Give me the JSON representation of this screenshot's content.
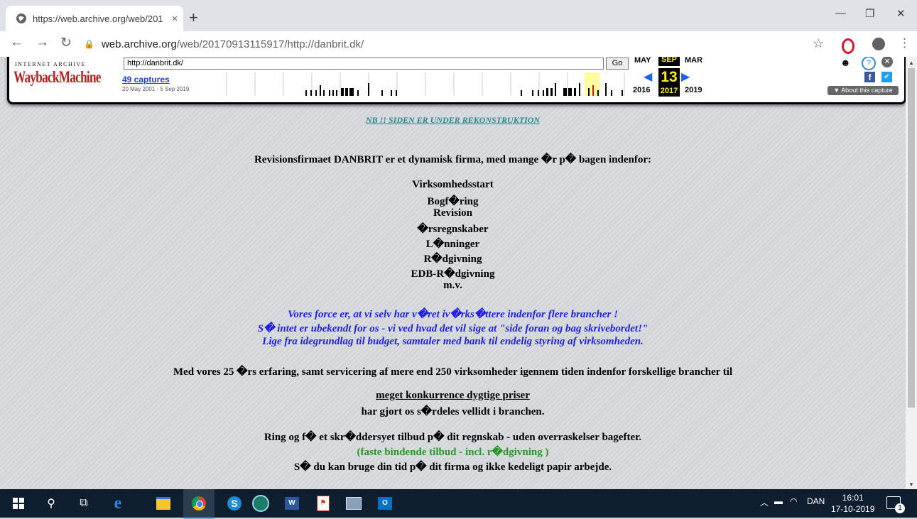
{
  "browser": {
    "tab_title": "https://web.archive.org/web/201",
    "close_glyph": "×",
    "new_tab_glyph": "+",
    "url_host": "web.archive.org",
    "url_path": "/web/20170913115917/http://danbrit.dk/",
    "window_controls": {
      "minimize": "—",
      "maximize": "❐",
      "close": "✕"
    }
  },
  "wayback": {
    "brand_top": "INTERNET ARCHIVE",
    "brand_logo": "WaybackMachine",
    "url_value": "http://danbrit.dk/",
    "go_label": "Go",
    "captures": "49 captures",
    "date_range": "20 May 2001 - 5 Sep 2019",
    "months": {
      "prev": "MAY",
      "current": "SEP",
      "next": "MAR"
    },
    "day": "13",
    "years": {
      "prev": "2016",
      "current": "2017",
      "next": "2019"
    },
    "about": "▼ About this capture"
  },
  "content": {
    "notice": "NB !! SIDEN ER UNDER REKONSTRUKTION",
    "intro": "Revisionsfirmaet DANBRIT er et dynamisk firma, med mange �r p� bagen indenfor:",
    "services": [
      "Virksomhedsstart",
      "Bogf�ring",
      "Revision",
      "�rsregnskaber",
      "L�nninger",
      "R�dgivning",
      "EDB-R�dgivning",
      "m.v."
    ],
    "blue_lines": [
      "Vores force er, at vi selv har v�ret iv�rks�ttere indenfor flere brancher !",
      "S� intet er ubekendt for os - vi ved hvad det vil sige at \"side foran og bag skrivebordet!\"",
      "Lige fra idegrundlag til budget, samtaler med bank til endelig styring af virksomheden."
    ],
    "experience": "Med vores 25 �rs erfaring, samt servicering af mere end 250 virksomheder igennem tiden indenfor forskellige brancher til",
    "prices": "meget konkurrence dygtige priser",
    "reputation": "har gjort os s�rdeles vellidt i branchen.",
    "call": "Ring og f� et skr�ddersyet tilbud p� dit regnskab - uden overraskelser bagefter.",
    "offer": "(faste bindende tilbud - incl. r�dgivning )",
    "closing": "S� du kan bruge din tid p� dit firma og ikke kedeligt papir arbejde."
  },
  "taskbar": {
    "language": "DAN",
    "time": "16:01",
    "date": "17-10-2019",
    "notifications": "1"
  }
}
